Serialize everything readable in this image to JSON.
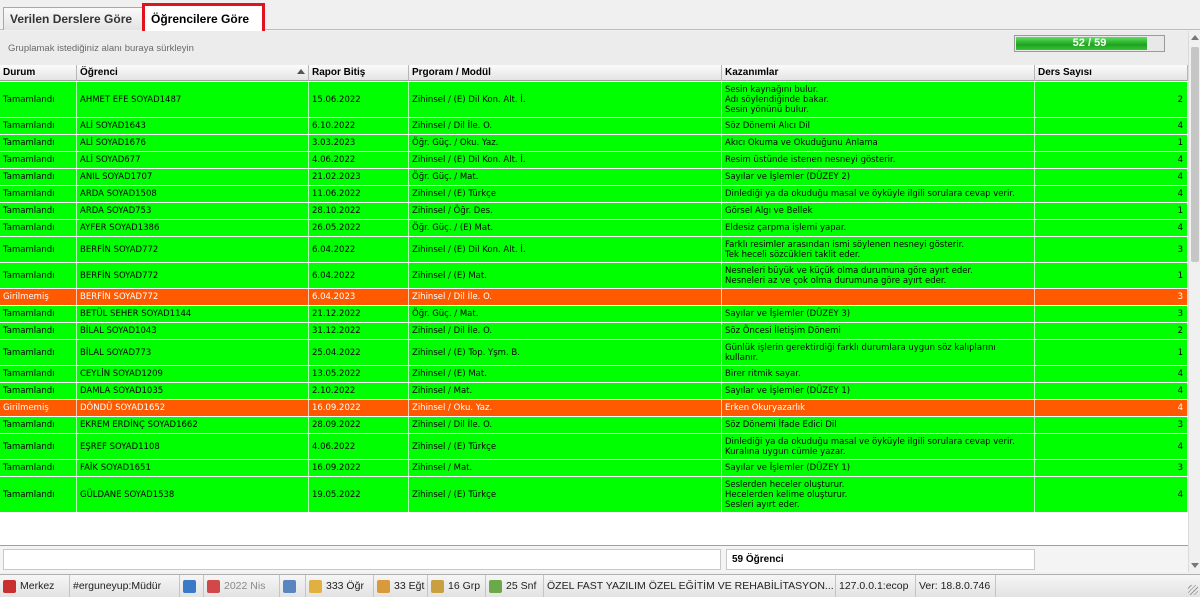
{
  "tabs": [
    {
      "label": "Verilen Derslere Göre",
      "active": false
    },
    {
      "label": "Öğrencilere Göre",
      "active": true
    }
  ],
  "group_panel": {
    "hint": "Gruplamak istediğiniz alanı buraya sürkleyin",
    "progress_text": "52 / 59",
    "progress_fraction": 0.88
  },
  "columns": [
    "Durum",
    "Öğrenci",
    "Rapor Bitiş",
    "Prgoram / Modül",
    "Kazanımlar",
    "Ders Sayısı"
  ],
  "rows": [
    {
      "durum": "Tamamlandı",
      "ogrenci": "AHMET EFE SOYAD1487",
      "rapor": "15.06.2022",
      "program": "Zihinsel / (E) Dil Kon. Alt. İ.",
      "kazanimlar": [
        "Sesin kaynağını bulur.",
        "Adı söylendiğinde bakar.",
        "Sesin yönünü bulur."
      ],
      "ders": "2",
      "status": "green"
    },
    {
      "durum": "Tamamlandı",
      "ogrenci": "ALİ SOYAD1643",
      "rapor": "6.10.2022",
      "program": "Zihinsel / Dil İle. O.",
      "kazanimlar": [
        "Söz Dönemi Alıcı Dil"
      ],
      "ders": "4",
      "status": "green"
    },
    {
      "durum": "Tamamlandı",
      "ogrenci": "ALİ SOYAD1676",
      "rapor": "3.03.2023",
      "program": "Öğr. Güç. / Oku. Yaz.",
      "kazanimlar": [
        "Akıcı Okuma ve Okuduğunu Anlama"
      ],
      "ders": "1",
      "status": "green"
    },
    {
      "durum": "Tamamlandı",
      "ogrenci": "ALİ SOYAD677",
      "rapor": "4.06.2022",
      "program": "Zihinsel / (E) Dil Kon. Alt. İ.",
      "kazanimlar": [
        "Resim üstünde istenen nesneyi gösterir."
      ],
      "ders": "4",
      "status": "green"
    },
    {
      "durum": "Tamamlandı",
      "ogrenci": "ANIL SOYAD1707",
      "rapor": "21.02.2023",
      "program": "Öğr. Güç. / Mat.",
      "kazanimlar": [
        "Sayılar ve İşlemler (DÜZEY 2)"
      ],
      "ders": "4",
      "status": "green"
    },
    {
      "durum": "Tamamlandı",
      "ogrenci": "ARDA SOYAD1508",
      "rapor": "11.06.2022",
      "program": "Zihinsel / (E) Türkçe",
      "kazanimlar": [
        "Dinlediği ya da okuduğu masal ve öyküyle ilgili sorulara cevap verir."
      ],
      "ders": "4",
      "status": "green"
    },
    {
      "durum": "Tamamlandı",
      "ogrenci": "ARDA SOYAD753",
      "rapor": "28.10.2022",
      "program": "Zihinsel / Öğr. Des.",
      "kazanimlar": [
        "Görsel Algı ve Bellek"
      ],
      "ders": "1",
      "status": "green"
    },
    {
      "durum": "Tamamlandı",
      "ogrenci": "AYFER SOYAD1386",
      "rapor": "26.05.2022",
      "program": "Öğr. Güç. / (E) Mat.",
      "kazanimlar": [
        "Eldesiz çarpma işlemi yapar."
      ],
      "ders": "4",
      "status": "green"
    },
    {
      "durum": "Tamamlandı",
      "ogrenci": "BERFİN SOYAD772",
      "rapor": "6.04.2022",
      "program": "Zihinsel / (E) Dil Kon. Alt. İ.",
      "kazanimlar": [
        "Farklı resimler arasından ismi söylenen nesneyi gösterir.",
        "Tek heceli sözcükleri taklit eder."
      ],
      "ders": "3",
      "status": "green"
    },
    {
      "durum": "Tamamlandı",
      "ogrenci": "BERFİN SOYAD772",
      "rapor": "6.04.2022",
      "program": "Zihinsel / (E) Mat.",
      "kazanimlar": [
        "Nesneleri büyük ve küçük olma durumuna göre ayırt eder.",
        "Nesneleri az ve çok olma durumuna göre ayırt eder."
      ],
      "ders": "1",
      "status": "green"
    },
    {
      "durum": "Girilmemiş",
      "ogrenci": "BERFİN SOYAD772",
      "rapor": "6.04.2023",
      "program": "Zihinsel / Dil İle. O.",
      "kazanimlar": [
        ""
      ],
      "ders": "3",
      "status": "orange"
    },
    {
      "durum": "Tamamlandı",
      "ogrenci": "BETÜL SEHER SOYAD1144",
      "rapor": "21.12.2022",
      "program": "Öğr. Güç. / Mat.",
      "kazanimlar": [
        "Sayılar ve İşlemler (DÜZEY 3)"
      ],
      "ders": "3",
      "status": "green"
    },
    {
      "durum": "Tamamlandı",
      "ogrenci": "BİLAL SOYAD1043",
      "rapor": "31.12.2022",
      "program": "Zihinsel / Dil İle. O.",
      "kazanimlar": [
        "Söz Öncesi İletişim Dönemi"
      ],
      "ders": "2",
      "status": "green"
    },
    {
      "durum": "Tamamlandı",
      "ogrenci": "BİLAL SOYAD773",
      "rapor": "25.04.2022",
      "program": "Zihinsel / (E) Top. Yşm. B.",
      "kazanimlar": [
        "Günlük işlerin gerektirdiği farklı durumlara uygun söz kalıplarını",
        "kullanır."
      ],
      "ders": "1",
      "status": "green"
    },
    {
      "durum": "Tamamlandı",
      "ogrenci": "CEYLİN SOYAD1209",
      "rapor": "13.05.2022",
      "program": "Zihinsel / (E) Mat.",
      "kazanimlar": [
        "Birer ritmik sayar."
      ],
      "ders": "4",
      "status": "green"
    },
    {
      "durum": "Tamamlandı",
      "ogrenci": "DAMLA SOYAD1035",
      "rapor": "2.10.2022",
      "program": "Zihinsel / Mat.",
      "kazanimlar": [
        "Sayılar ve İşlemler (DÜZEY 1)"
      ],
      "ders": "4",
      "status": "green"
    },
    {
      "durum": "Girilmemiş",
      "ogrenci": "DÖNDÜ SOYAD1652",
      "rapor": "16.09.2022",
      "program": "Zihinsel / Oku. Yaz.",
      "kazanimlar": [
        "Erken Okuryazarlık"
      ],
      "ders": "4",
      "status": "orange"
    },
    {
      "durum": "Tamamlandı",
      "ogrenci": "EKREM ERDİNÇ SOYAD1662",
      "rapor": "28.09.2022",
      "program": "Zihinsel / Dil İle. O.",
      "kazanimlar": [
        "Söz Dönemi İfade Edici Dil"
      ],
      "ders": "3",
      "status": "green"
    },
    {
      "durum": "Tamamlandı",
      "ogrenci": "EŞREF SOYAD1108",
      "rapor": "4.06.2022",
      "program": "Zihinsel / (E) Türkçe",
      "kazanimlar": [
        "Dinlediği ya da okuduğu masal ve öyküyle ilgili sorulara cevap verir.",
        "Kuralına uygun cümle yazar."
      ],
      "ders": "4",
      "status": "green"
    },
    {
      "durum": "Tamamlandı",
      "ogrenci": "FAİK SOYAD1651",
      "rapor": "16.09.2022",
      "program": "Zihinsel / Mat.",
      "kazanimlar": [
        "Sayılar ve İşlemler (DÜZEY 1)"
      ],
      "ders": "3",
      "status": "green"
    },
    {
      "durum": "Tamamlandı",
      "ogrenci": "GÜLDANE SOYAD1538",
      "rapor": "19.05.2022",
      "program": "Zihinsel / (E) Türkçe",
      "kazanimlar": [
        "Seslerden heceler oluşturur.",
        "Hecelerden kelime oluşturur.",
        "Sesleri ayırt eder."
      ],
      "ders": "4",
      "status": "green"
    }
  ],
  "footer": {
    "count_label": "59 Öğrenci"
  },
  "statusbar": {
    "branch": "Merkez",
    "user": "#erguneyup:Müdür",
    "period": "2022 Nis",
    "students": "333 Öğr",
    "teachers": "33 Eğt",
    "groups": "16 Grp",
    "classes": "25 Snf",
    "institution": "ÖZEL FAST YAZILIM ÖZEL EĞİTİM VE REHABİLİTASYON...",
    "server": "127.0.0.1:ecop",
    "version": "Ver: 18.8.0.746"
  },
  "colors": {
    "complete": "#00ff00",
    "missing": "#ff5a00",
    "tab_highlight": "#e0141e"
  }
}
